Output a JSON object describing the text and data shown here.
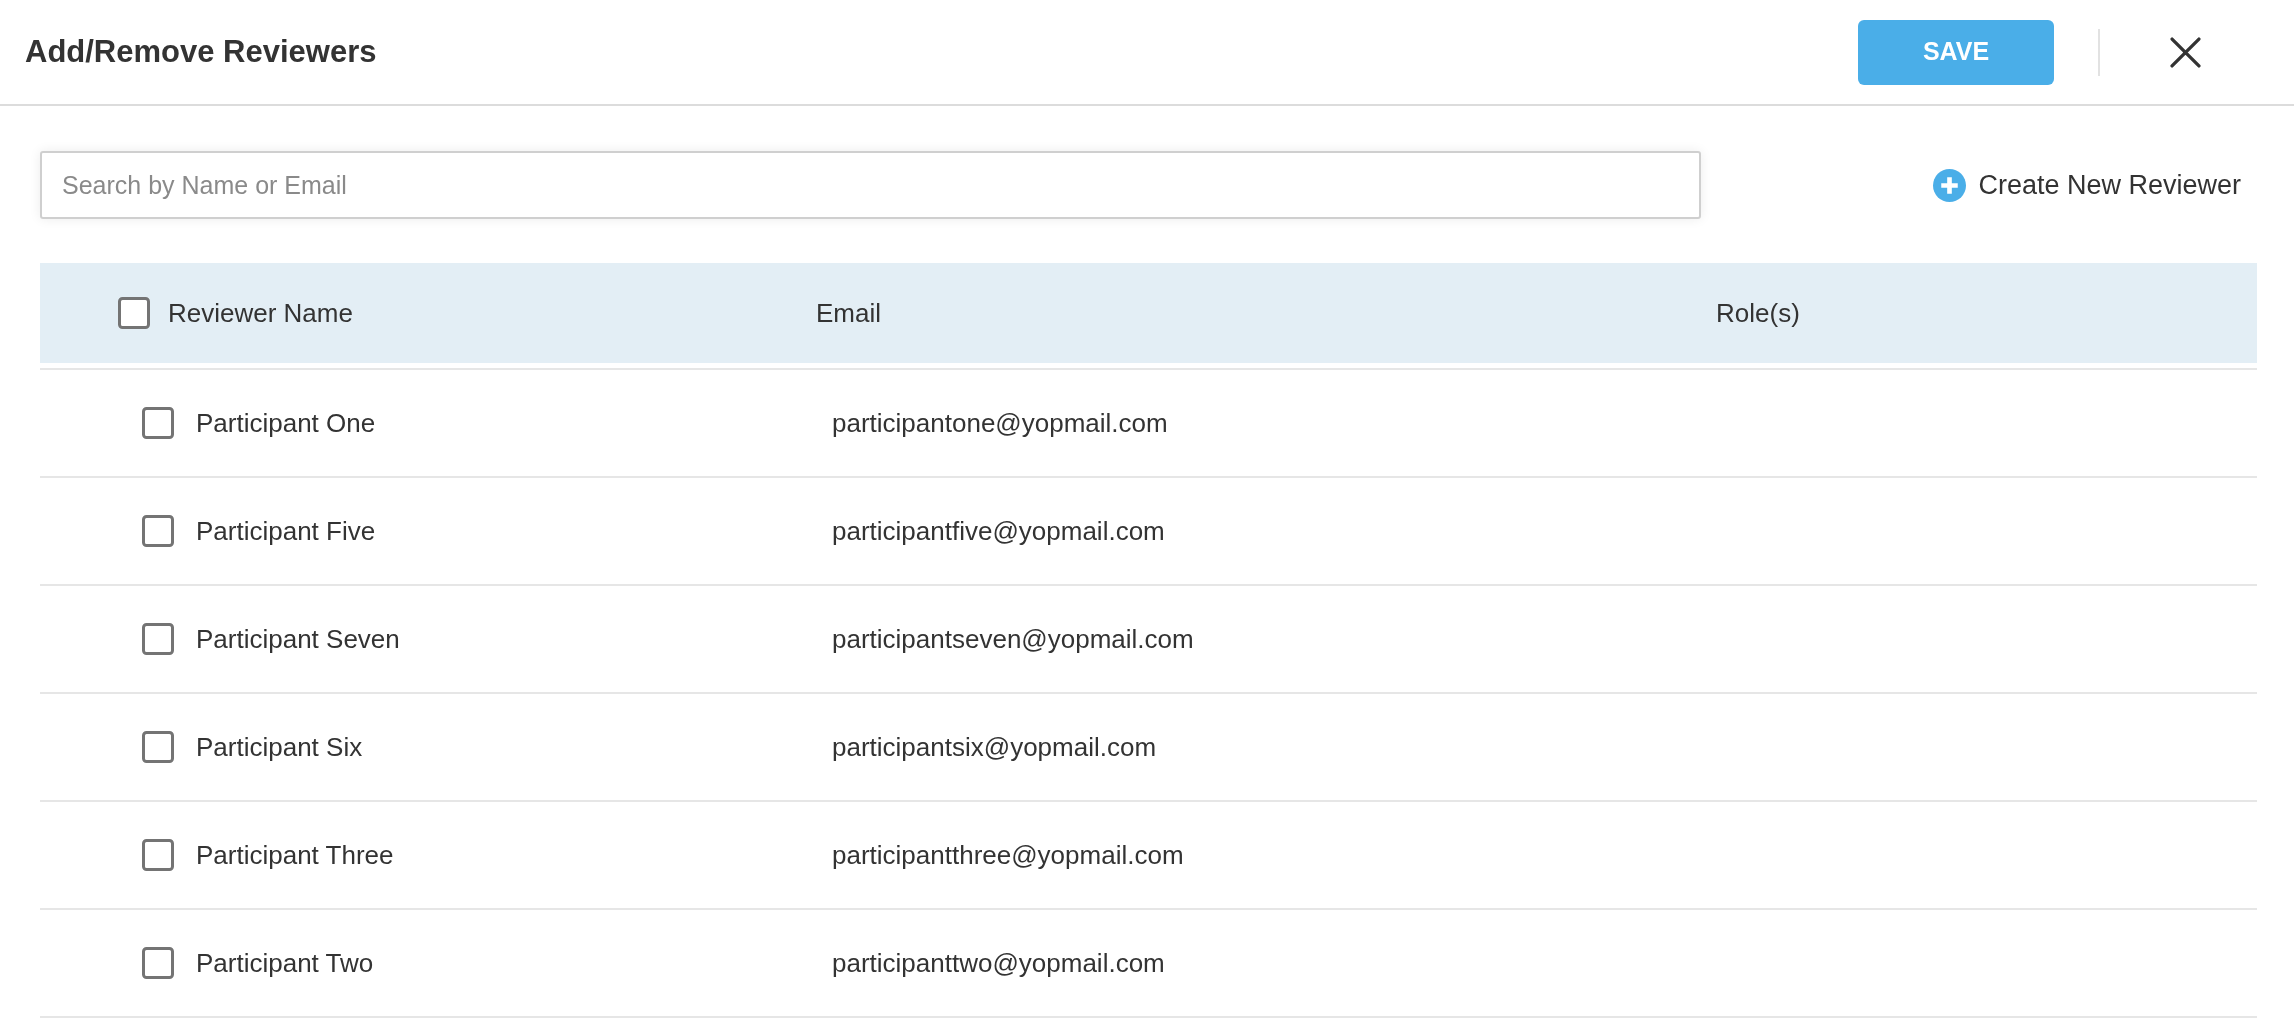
{
  "dialog": {
    "title": "Add/Remove Reviewers",
    "save_button": {
      "label": "SAVE"
    }
  },
  "search": {
    "placeholder": "Search by Name or Email"
  },
  "create_button": {
    "label": "Create New Reviewer"
  },
  "table": {
    "select_all": {
      "checked": false
    },
    "columns": [
      "Reviewer Name",
      "Email",
      "Role(s)"
    ],
    "rows": [
      {
        "name": "Participant One",
        "email": "participantone@yopmail.com",
        "checked": false
      },
      {
        "name": "Participant Five",
        "email": "participantfive@yopmail.com",
        "checked": false
      },
      {
        "name": "Participant Seven",
        "email": "participantseven@yopmail.com",
        "checked": false
      },
      {
        "name": "Participant Six",
        "email": "participantsix@yopmail.com",
        "checked": false
      },
      {
        "name": "Participant Three",
        "email": "participantthree@yopmail.com",
        "checked": false
      },
      {
        "name": "Participant Two",
        "email": "participanttwo@yopmail.com",
        "checked": false
      }
    ]
  }
}
